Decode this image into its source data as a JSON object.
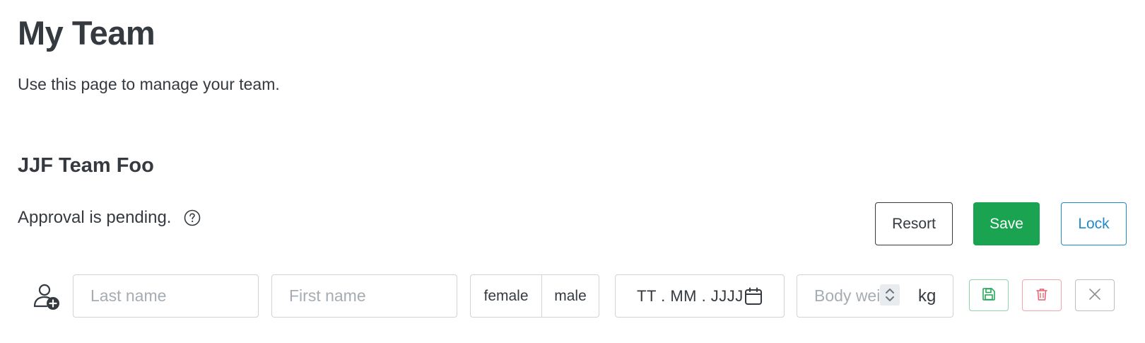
{
  "page": {
    "title": "My Team",
    "description": "Use this page to manage your team."
  },
  "team": {
    "name": "JJF Team Foo",
    "approval_status": "Approval is pending.",
    "actions": {
      "resort_label": "Resort",
      "save_label": "Save",
      "lock_label": "Lock"
    }
  },
  "new_member_row": {
    "last_name_placeholder": "Last name",
    "first_name_placeholder": "First name",
    "gender_options": [
      "female",
      "male"
    ],
    "birthdate_placeholder": "TT . MM . JJJJ",
    "body_weight_placeholder": "Body weight",
    "body_weight_unit": "kg",
    "icons": {
      "add_person": "person-add-icon",
      "help": "question-circle-icon",
      "calendar": "calendar-icon",
      "spinner": "chevron-up-down-icon",
      "save": "floppy-disk-icon",
      "delete": "trash-icon",
      "cancel": "close-icon"
    }
  },
  "colors": {
    "text": "#343a40",
    "success": "#1aa350",
    "primary": "#1f8ac8",
    "danger": "#e4606d",
    "border": "#d0d4d8",
    "placeholder": "#a6acb3"
  }
}
